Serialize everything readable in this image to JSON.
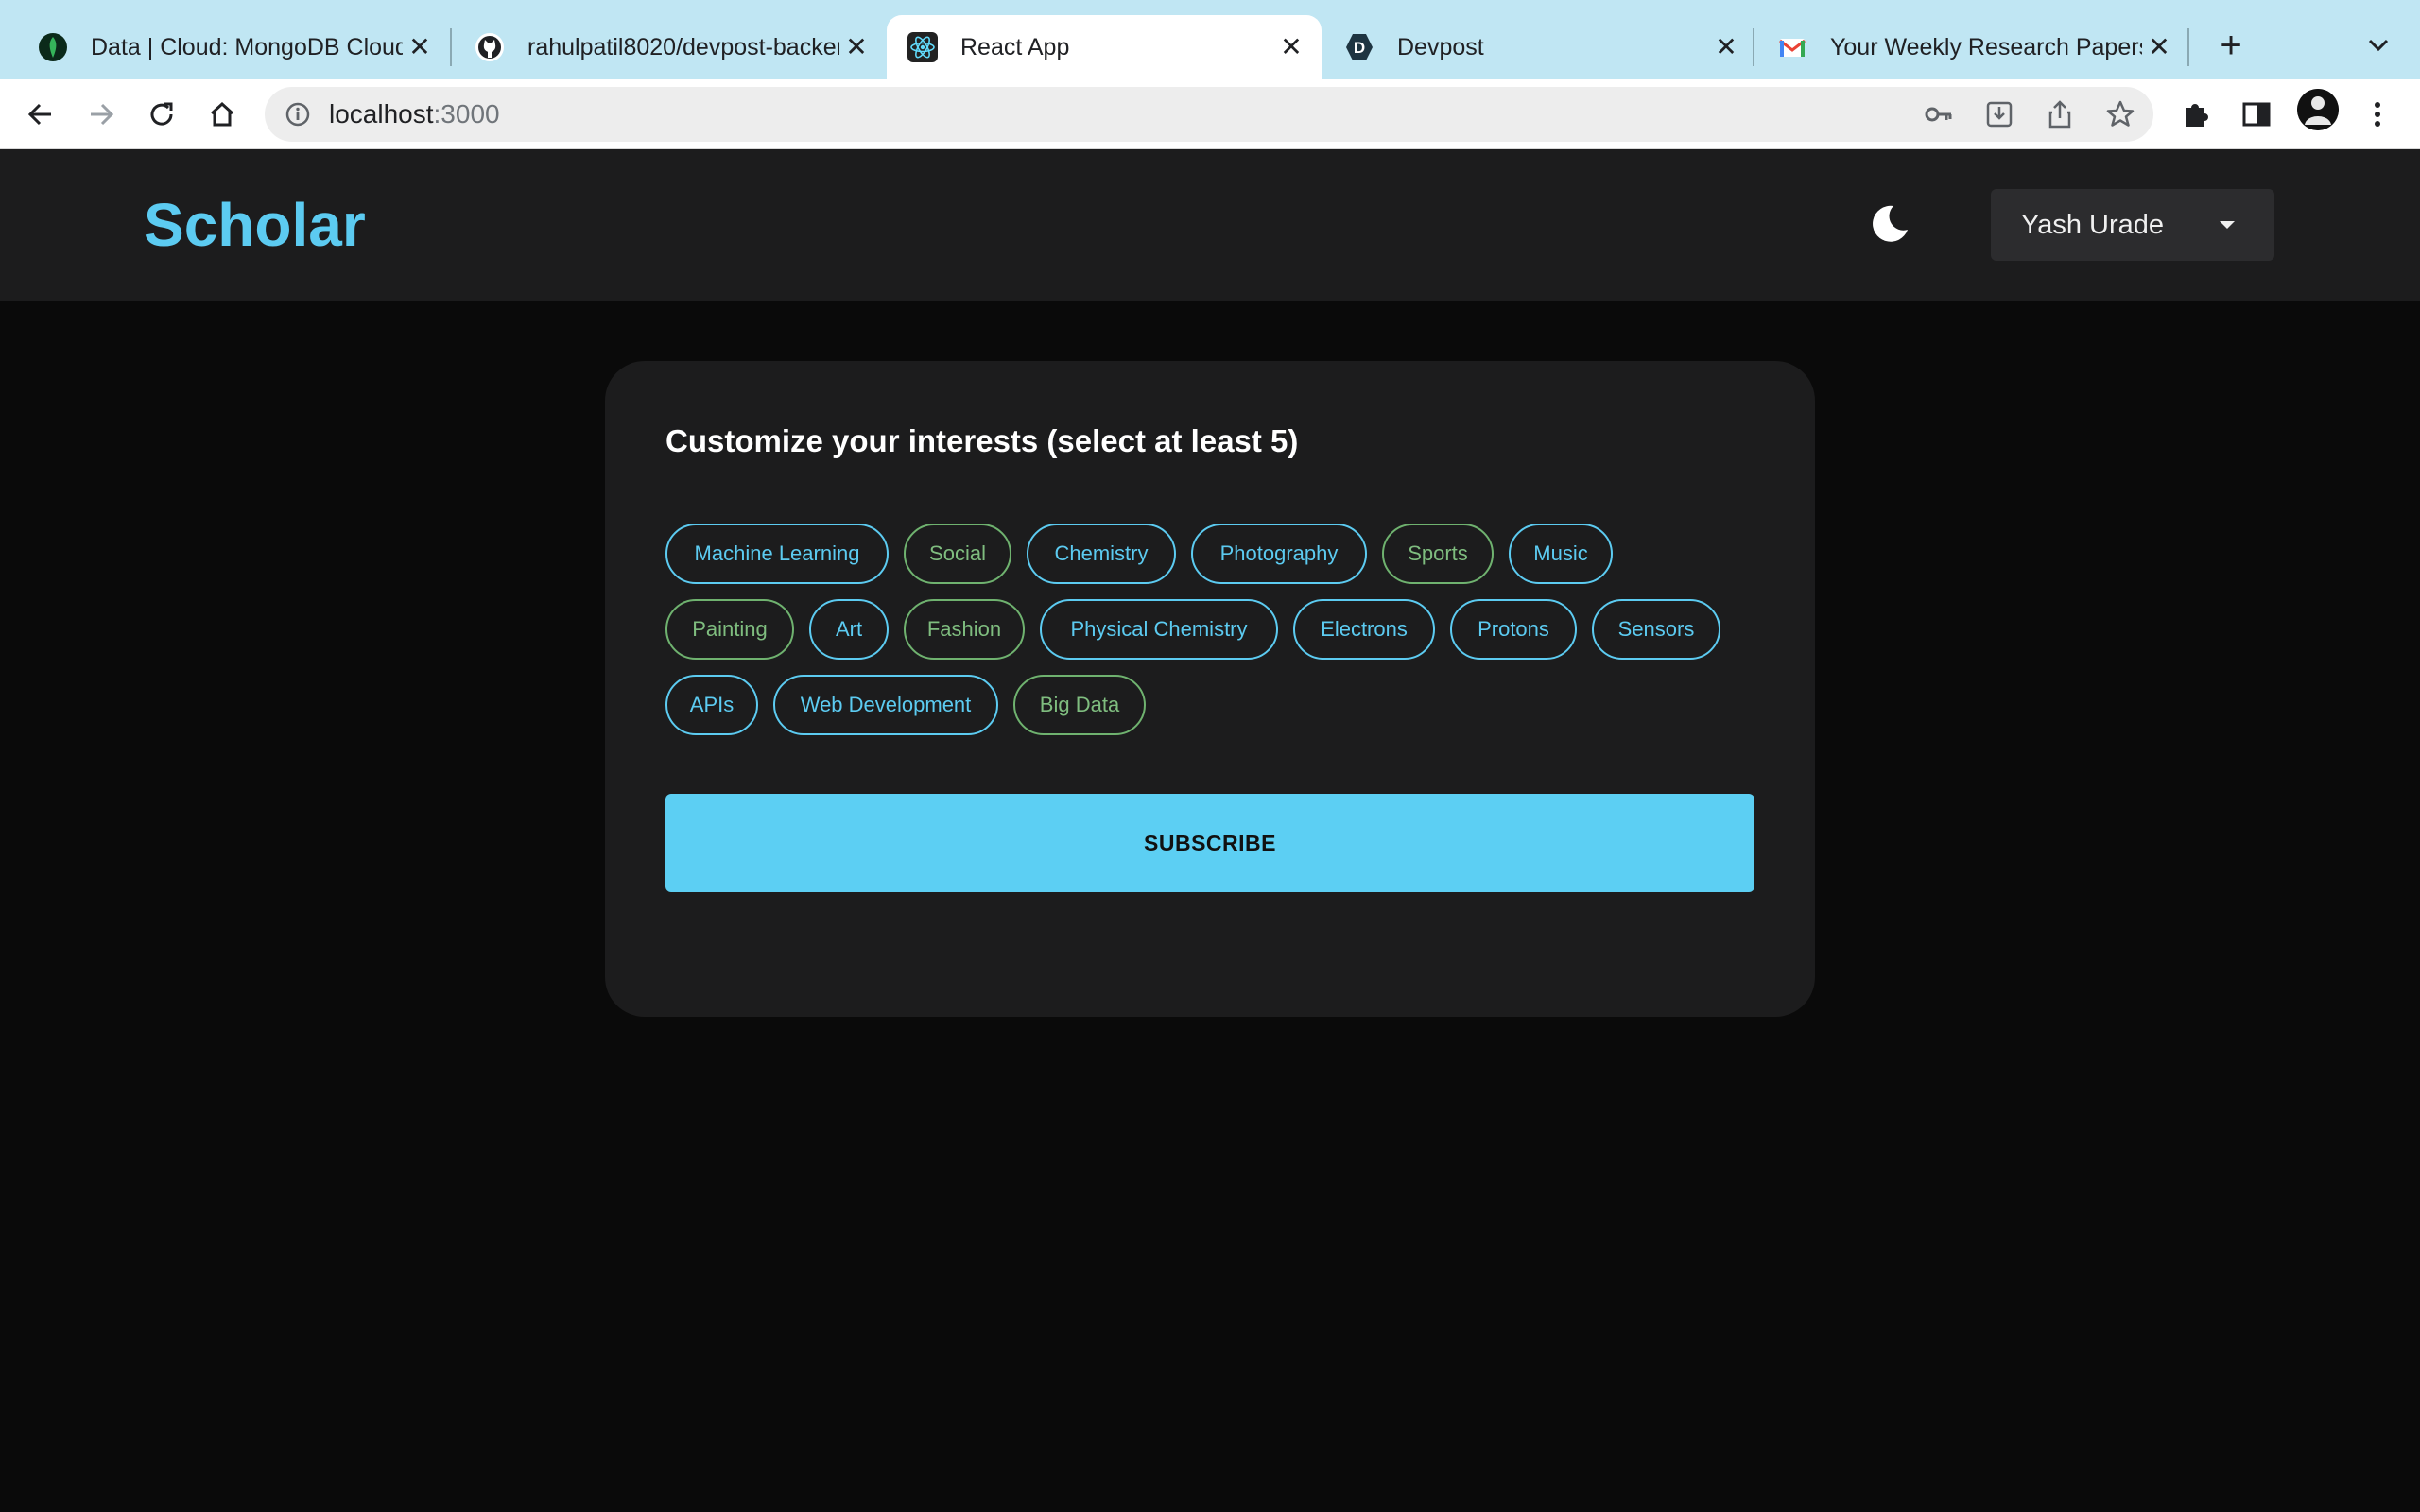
{
  "browser": {
    "tabs": [
      {
        "title": "Data | Cloud: MongoDB Cloud",
        "icon": "mongodb-leaf-icon"
      },
      {
        "title": "rahulpatil8020/devpost-backend",
        "icon": "github-icon"
      },
      {
        "title": "React App",
        "icon": "react-icon"
      },
      {
        "title": "Devpost",
        "icon": "devpost-icon"
      },
      {
        "title": "Your Weekly Research Papers",
        "icon": "gmail-icon"
      }
    ],
    "active_tab": 2,
    "new_tab_label": "+",
    "close_label": "✕",
    "address": {
      "host": "localhost",
      "port": ":3000"
    }
  },
  "app": {
    "brand": "Scholar",
    "brand_color": "#5ccbf1",
    "user_name": "Yash Urade",
    "card_title": "Customize your interests (select at least 5)",
    "interests": [
      {
        "label": "Machine Learning",
        "color": "blue"
      },
      {
        "label": "Social",
        "color": "green"
      },
      {
        "label": "Chemistry",
        "color": "blue"
      },
      {
        "label": "Photography",
        "color": "blue"
      },
      {
        "label": "Sports",
        "color": "green"
      },
      {
        "label": "Music",
        "color": "blue"
      },
      {
        "label": "Painting",
        "color": "green"
      },
      {
        "label": "Art",
        "color": "blue"
      },
      {
        "label": "Fashion",
        "color": "green"
      },
      {
        "label": "Physical Chemistry",
        "color": "blue"
      },
      {
        "label": "Electrons",
        "color": "blue"
      },
      {
        "label": "Protons",
        "color": "blue"
      },
      {
        "label": "Sensors",
        "color": "blue"
      },
      {
        "label": "APIs",
        "color": "blue"
      },
      {
        "label": "Web Development",
        "color": "blue"
      },
      {
        "label": "Big Data",
        "color": "green"
      }
    ],
    "subscribe_label": "SUBSCRIBE"
  }
}
